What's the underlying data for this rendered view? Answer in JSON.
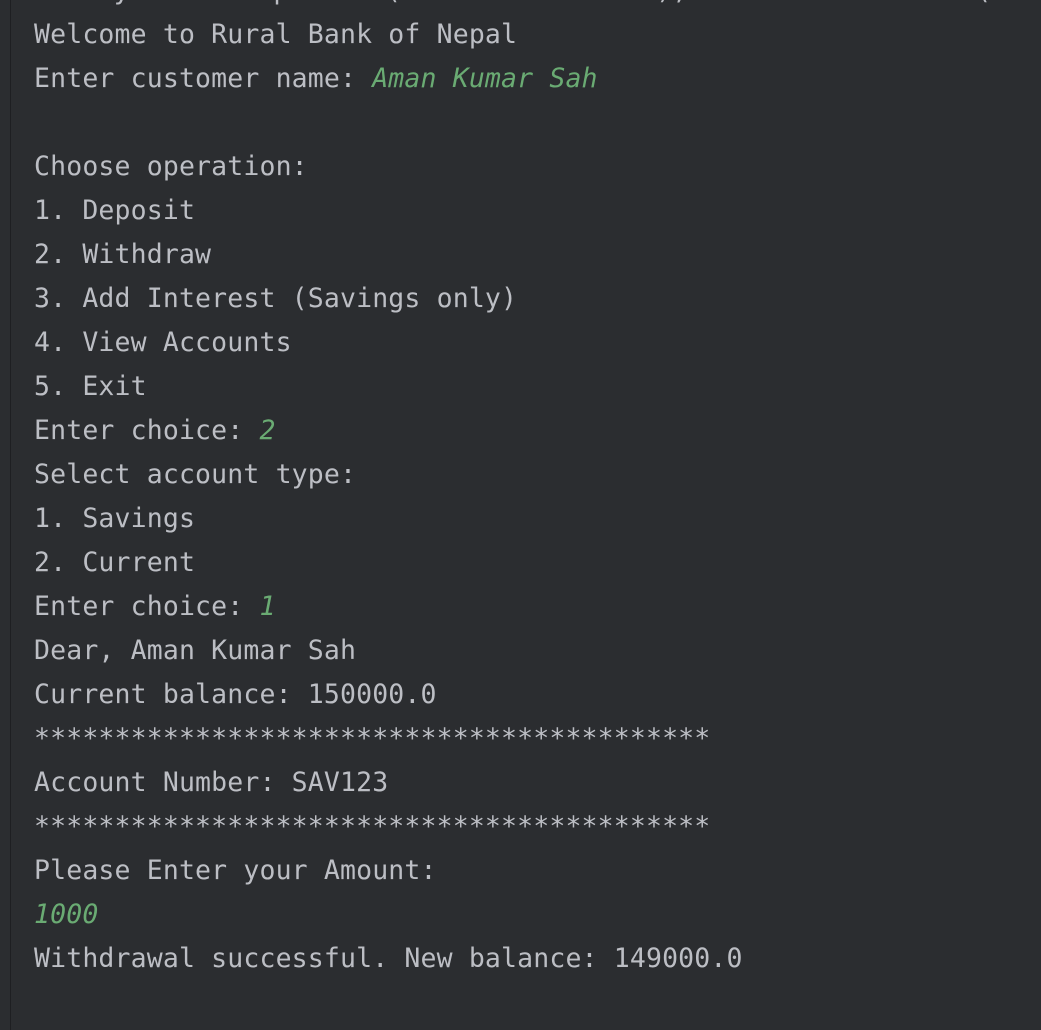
{
  "console": {
    "clipped_top_line": "    System.out.println(\"Enter amount: \");  account.withdraw(amount);",
    "lines": [
      {
        "prompt": "Welcome to Rural Bank of Nepal",
        "input": ""
      },
      {
        "prompt": "Enter customer name: ",
        "input": "Aman Kumar Sah"
      },
      {
        "prompt": "",
        "input": ""
      },
      {
        "prompt": "Choose operation:",
        "input": ""
      },
      {
        "prompt": "1. Deposit",
        "input": ""
      },
      {
        "prompt": "2. Withdraw",
        "input": ""
      },
      {
        "prompt": "3. Add Interest (Savings only)",
        "input": ""
      },
      {
        "prompt": "4. View Accounts",
        "input": ""
      },
      {
        "prompt": "5. Exit",
        "input": ""
      },
      {
        "prompt": "Enter choice: ",
        "input": "2"
      },
      {
        "prompt": "Select account type:",
        "input": ""
      },
      {
        "prompt": "1. Savings",
        "input": ""
      },
      {
        "prompt": "2. Current",
        "input": ""
      },
      {
        "prompt": "Enter choice: ",
        "input": "1"
      },
      {
        "prompt": "Dear, Aman Kumar Sah",
        "input": ""
      },
      {
        "prompt": "Current balance: 150000.0",
        "input": ""
      },
      {
        "prompt": "******************************************",
        "input": ""
      },
      {
        "prompt": "Account Number: SAV123",
        "input": ""
      },
      {
        "prompt": "******************************************",
        "input": ""
      },
      {
        "prompt": "Please Enter your Amount:",
        "input": ""
      },
      {
        "prompt": "",
        "input": "1000"
      },
      {
        "prompt": "Withdrawal successful. New balance: 149000.0",
        "input": ""
      }
    ]
  }
}
